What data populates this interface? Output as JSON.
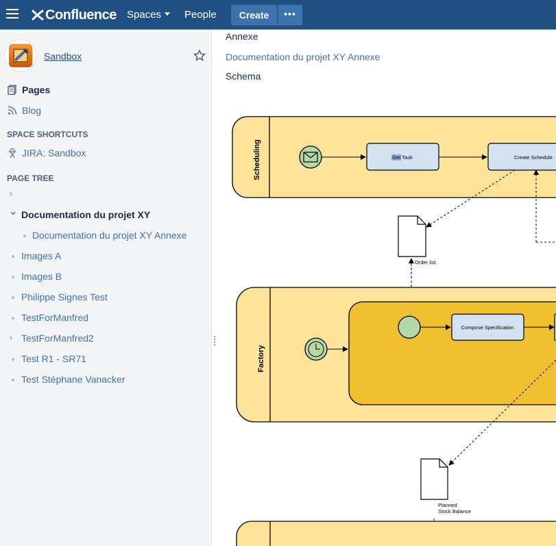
{
  "header": {
    "logo_text": "Confluence",
    "spaces_label": "Spaces",
    "people_label": "People",
    "create_label": "Create",
    "more_label": "•••",
    "background_color": "#205081",
    "create_color": "#3b73af"
  },
  "sidebar": {
    "space_name": "Sandbox",
    "pages_label": "Pages",
    "blog_label": "Blog",
    "shortcuts_heading": "SPACE SHORTCUTS",
    "shortcut_jira": "JIRA: Sandbox",
    "page_tree_heading": "PAGE TREE",
    "tree": {
      "current": "Documentation du projet XY",
      "child": "Documentation du projet XY Annexe",
      "items": [
        "Images A",
        "Images B",
        "Philippe Signes Test",
        "TestForManfred",
        "TestForManfred2",
        "Test R1 - SR71",
        "Test Stéphane Vanacker"
      ]
    }
  },
  "content": {
    "annexe_label": "Annexe",
    "annexe_link": "Documentation du projet XY Annexe",
    "schema_label": "Schema"
  },
  "diagram": {
    "lane_scheduling": "Scheduling",
    "lane_factory": "Factory",
    "task_get": "Get Task",
    "task_create_schedule": "Create Schedule",
    "doc_order_list": "Order list",
    "task_compose_spec": "Compose Specification",
    "doc_planned_line1": "Planned",
    "doc_planned_line2": "Stock Balance",
    "colors": {
      "lane_fill": "#fde49a",
      "subprocess_fill": "#f0c030",
      "task_fill": "#d4e1f1",
      "event_fill": "#b4d9a6"
    }
  },
  "icons": {
    "menu": "hamburger-icon",
    "pages": "pages-icon",
    "blog": "rss-icon",
    "jira": "jira-icon",
    "star": "star-icon"
  }
}
